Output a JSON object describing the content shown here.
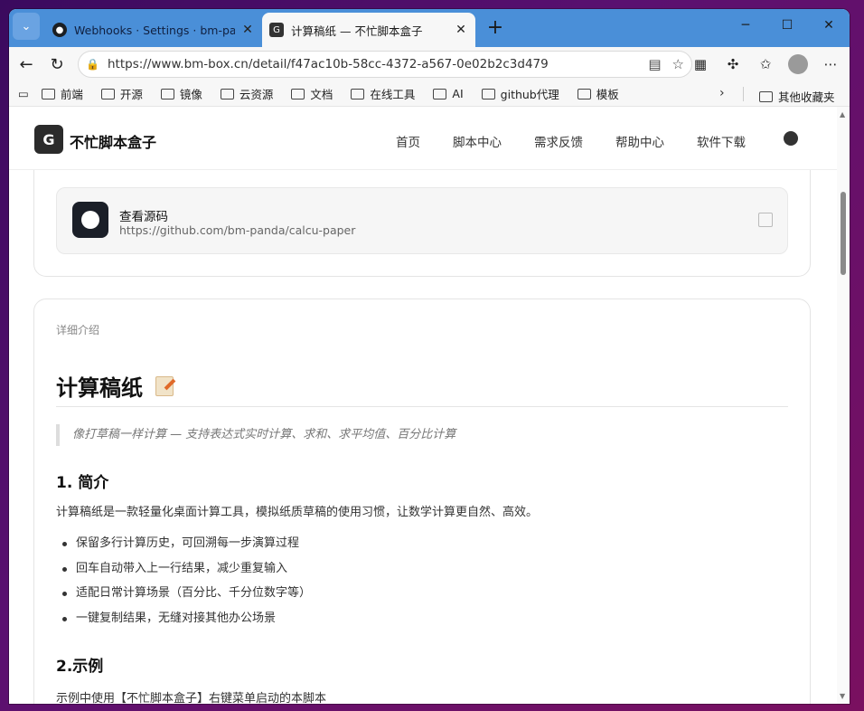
{
  "browser": {
    "tabs": [
      {
        "label": "Webhooks · Settings · bm-panda/r",
        "active": false
      },
      {
        "label": "计算稿纸 — 不忙脚本盒子",
        "active": true
      }
    ],
    "url": "https://www.bm-box.cn/detail/f47ac10b-58cc-4372-a567-0e02b2c3d479",
    "bookmarks": [
      "前端",
      "开源",
      "镜像",
      "云资源",
      "文档",
      "在线工具",
      "AI",
      "github代理",
      "模板"
    ],
    "other_bookmarks": "其他收藏夹"
  },
  "site": {
    "logo_letter": "G",
    "name": "不忙脚本盒子",
    "nav": [
      "首页",
      "脚本中心",
      "需求反馈",
      "帮助中心",
      "软件下载"
    ]
  },
  "source": {
    "title": "查看源码",
    "url": "https://github.com/bm-panda/calcu-paper"
  },
  "detail": {
    "label": "详细介绍",
    "title": "计算稿纸",
    "quote": "像打草稿一样计算 — 支持表达式实时计算、求和、求平均值、百分比计算",
    "section1_heading": "1. 简介",
    "section1_para": "计算稿纸是一款轻量化桌面计算工具，模拟纸质草稿的使用习惯，让数学计算更自然、高效。",
    "bullets": [
      "保留多行计算历史，可回溯每一步演算过程",
      "回车自动带入上一行结果，减少重复输入",
      "适配日常计算场景（百分比、千分位数字等）",
      "一键复制结果，无缝对接其他办公场景"
    ],
    "section2_heading": "2.示例",
    "section2_para": "示例中使用【不忙脚本盒子】右键菜单启动的本脚本"
  }
}
